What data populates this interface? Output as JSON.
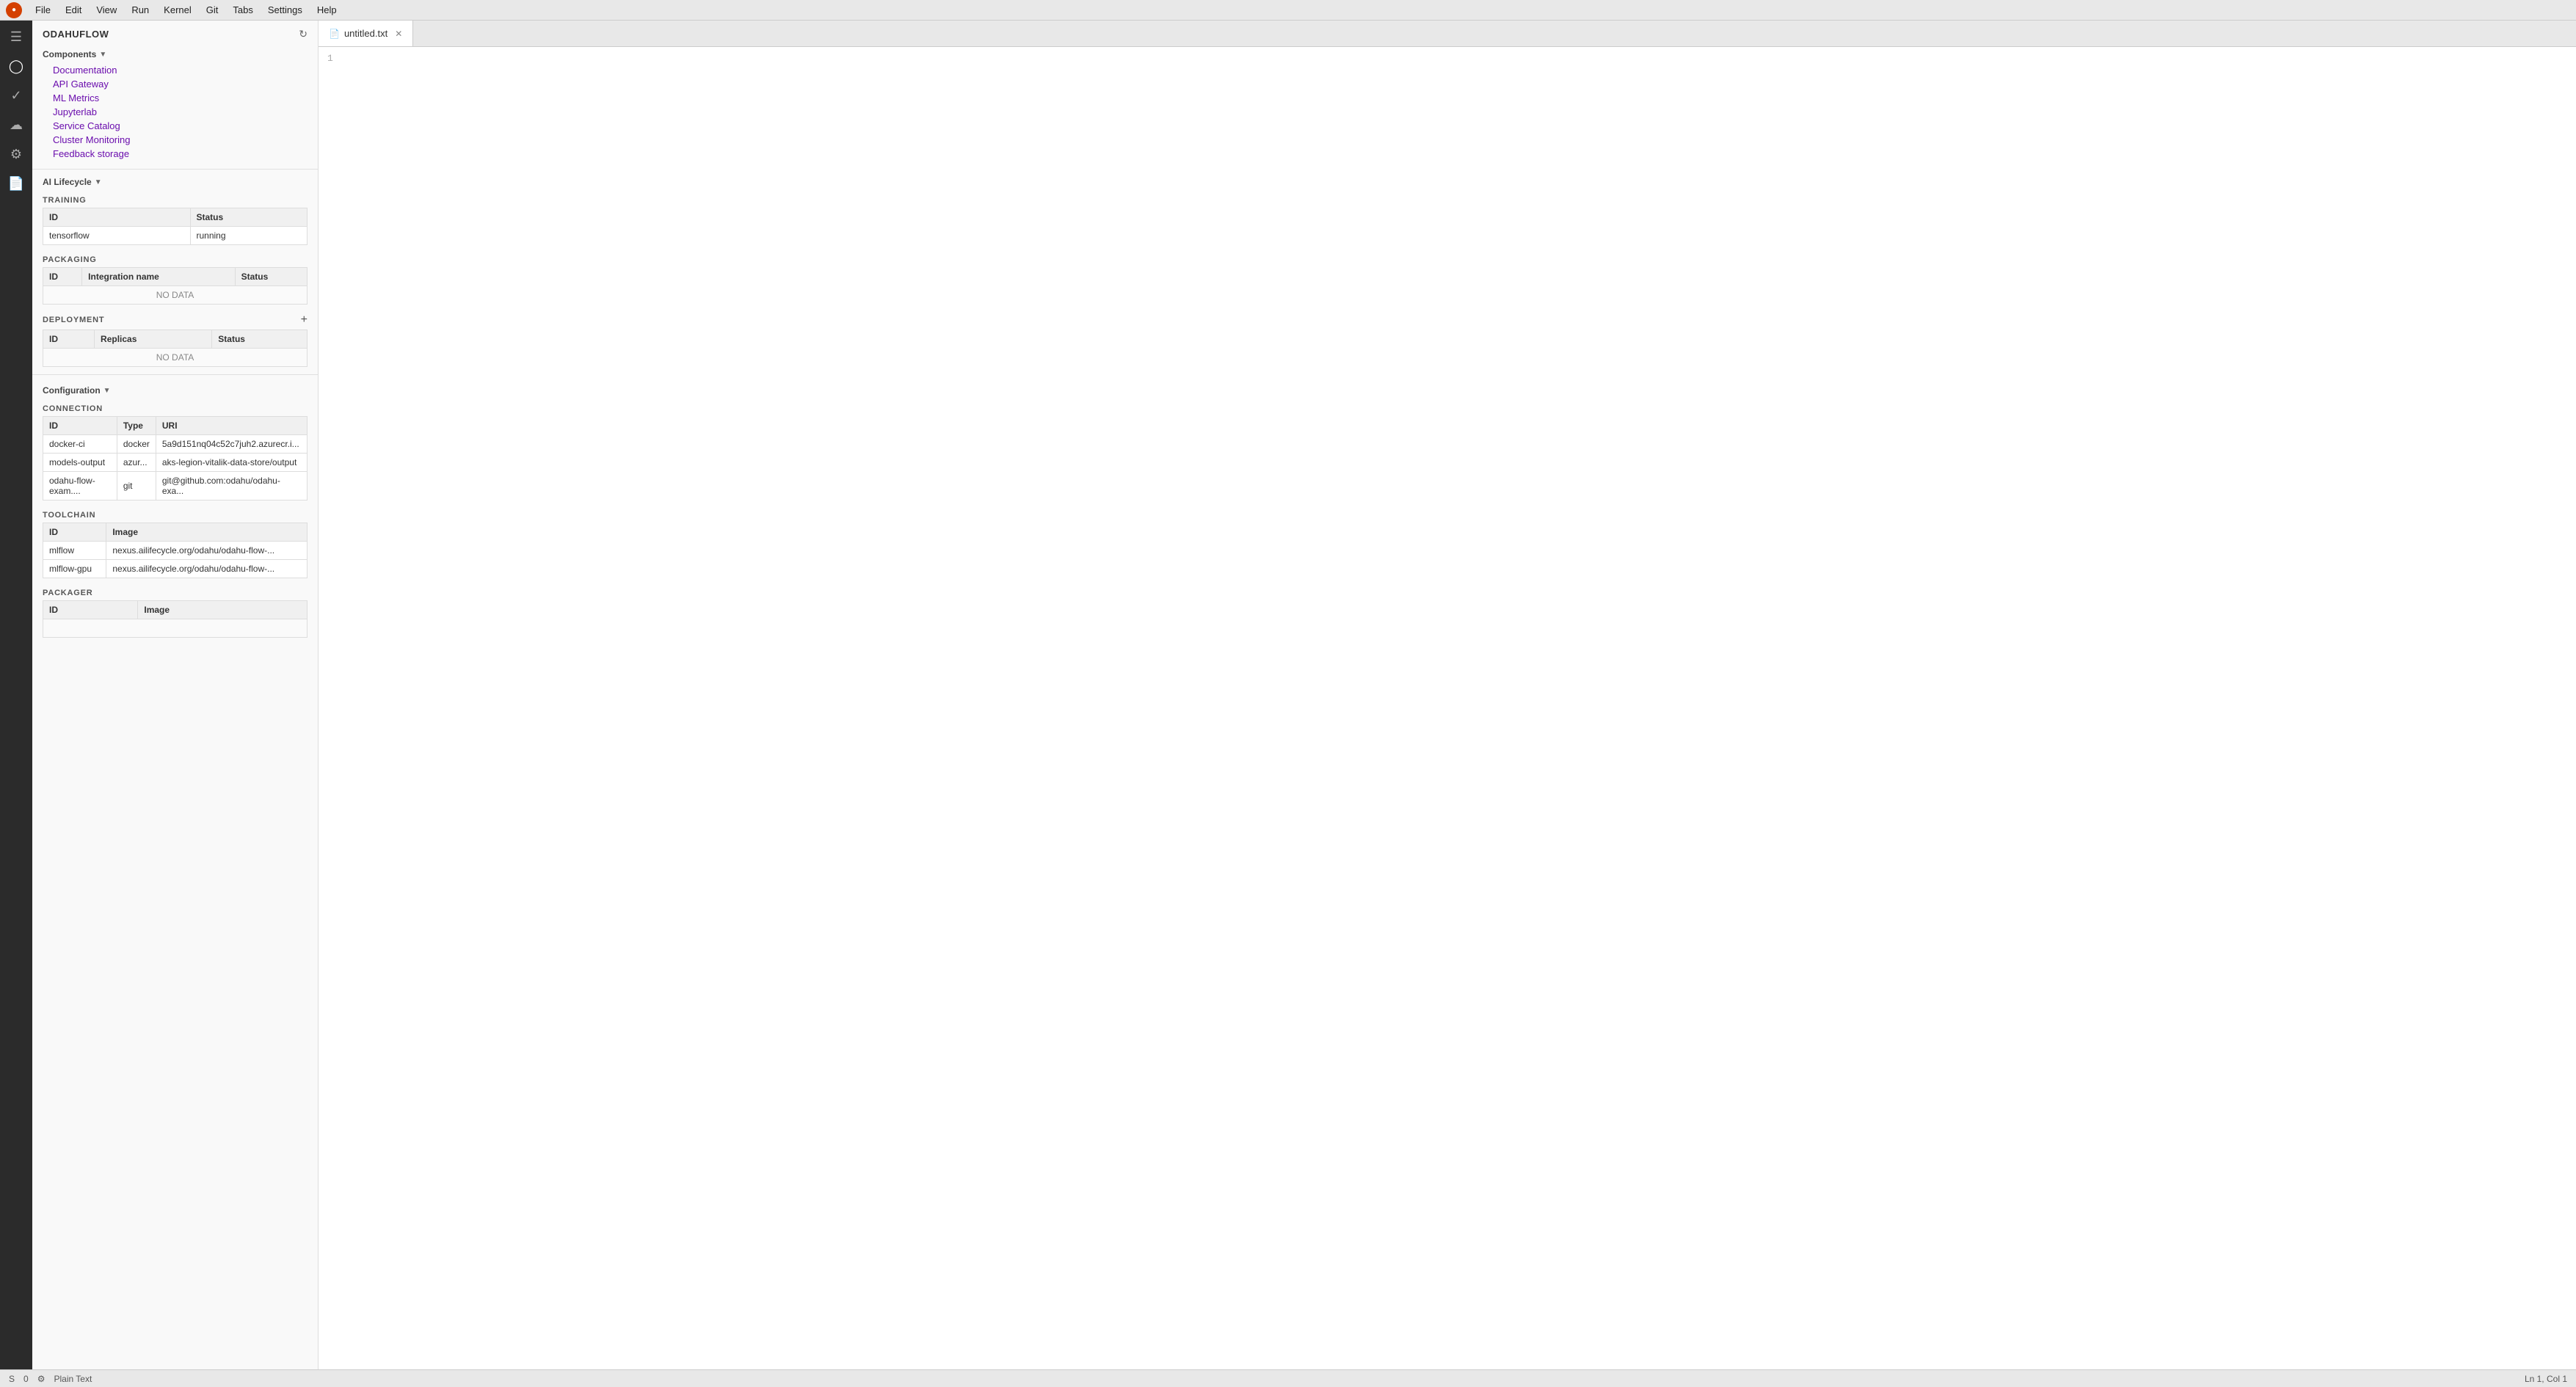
{
  "menubar": {
    "items": [
      "File",
      "Edit",
      "View",
      "Run",
      "Kernel",
      "Git",
      "Tabs",
      "Settings",
      "Help"
    ]
  },
  "sidebar": {
    "title": "ODAHUFLOW",
    "components_label": "Components",
    "components": [
      {
        "label": "Documentation"
      },
      {
        "label": "API Gateway"
      },
      {
        "label": "ML Metrics"
      },
      {
        "label": "Jupyterlab"
      },
      {
        "label": "Service Catalog"
      },
      {
        "label": "Cluster Monitoring"
      },
      {
        "label": "Feedback storage"
      }
    ],
    "ai_lifecycle_label": "AI Lifecycle",
    "training": {
      "section_label": "TRAINING",
      "columns": [
        "ID",
        "Status"
      ],
      "rows": [
        {
          "id": "tensorflow",
          "status": "running"
        }
      ]
    },
    "packaging": {
      "section_label": "PACKAGING",
      "columns": [
        "ID",
        "Integration name",
        "Status"
      ],
      "no_data": "NO DATA"
    },
    "deployment": {
      "section_label": "DEPLOYMENT",
      "columns": [
        "ID",
        "Replicas",
        "Status"
      ],
      "no_data": "NO DATA"
    },
    "configuration_label": "Configuration",
    "connection": {
      "section_label": "CONNECTION",
      "columns": [
        "ID",
        "Type",
        "URI"
      ],
      "rows": [
        {
          "id": "docker-ci",
          "type": "docker",
          "uri": "5a9d151nq04c52c7juh2.azurecr.i..."
        },
        {
          "id": "models-output",
          "type": "azur...",
          "uri": "aks-legion-vitalik-data-store/output"
        },
        {
          "id": "odahu-flow-exam....",
          "type": "git",
          "uri": "git@github.com:odahu/odahu-exa..."
        }
      ]
    },
    "toolchain": {
      "section_label": "TOOLCHAIN",
      "columns": [
        "ID",
        "Image"
      ],
      "rows": [
        {
          "id": "mlflow",
          "image": "nexus.ailifecycle.org/odahu/odahu-flow-..."
        },
        {
          "id": "mlflow-gpu",
          "image": "nexus.ailifecycle.org/odahu/odahu-flow-..."
        }
      ]
    },
    "packager": {
      "section_label": "PACKAGER",
      "columns": [
        "ID",
        "Image"
      ],
      "rows": []
    }
  },
  "editor": {
    "tab_label": "untitled.txt",
    "line_number": "1"
  },
  "statusbar": {
    "left": [
      "S",
      "0"
    ],
    "plain_text": "Plain Text",
    "right": "Ln 1, Col 1"
  }
}
